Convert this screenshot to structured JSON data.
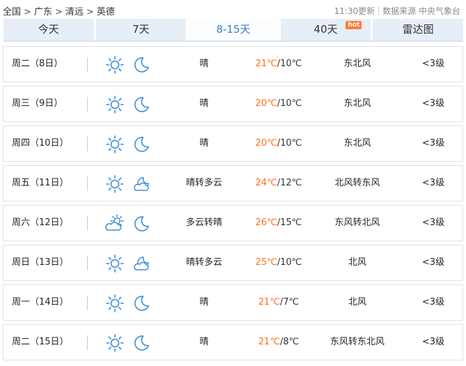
{
  "breadcrumb": {
    "items": [
      "全国",
      "广东",
      "清远",
      "英德"
    ],
    "separator": ">"
  },
  "update_time": "11:30更新",
  "source": "数据来源 中央气象台",
  "tabs": [
    {
      "label": "今天"
    },
    {
      "label": "7天"
    },
    {
      "label": "8-15天",
      "active": true
    },
    {
      "label": "40天",
      "badge": "hot"
    },
    {
      "label": "雷达图"
    }
  ],
  "days": [
    {
      "date": "周二（8日）",
      "day_icon": "sun-icon",
      "night_icon": "moon-icon",
      "weather": "晴",
      "high": "21℃",
      "low": "/10℃",
      "wind": "东北风",
      "level": "<3级"
    },
    {
      "date": "周三（9日）",
      "day_icon": "sun-icon",
      "night_icon": "moon-icon",
      "weather": "晴",
      "high": "20℃",
      "low": "/10℃",
      "wind": "东北风",
      "level": "<3级"
    },
    {
      "date": "周四（10日）",
      "day_icon": "sun-icon",
      "night_icon": "moon-icon",
      "weather": "晴",
      "high": "20℃",
      "low": "/10℃",
      "wind": "东北风",
      "level": "<3级"
    },
    {
      "date": "周五（11日）",
      "day_icon": "sun-icon",
      "night_icon": "moon-cloud-icon",
      "weather": "晴转多云",
      "high": "24℃",
      "low": "/12℃",
      "wind": "北风转东风",
      "level": "<3级"
    },
    {
      "date": "周六（12日）",
      "day_icon": "sun-cloud-icon",
      "night_icon": "moon-icon",
      "weather": "多云转晴",
      "high": "26℃",
      "low": "/15℃",
      "wind": "东风转北风",
      "level": "<3级"
    },
    {
      "date": "周日（13日）",
      "day_icon": "sun-icon",
      "night_icon": "moon-cloud-icon",
      "weather": "晴转多云",
      "high": "25℃",
      "low": "/10℃",
      "wind": "北风",
      "level": "<3级"
    },
    {
      "date": "周一（14日）",
      "day_icon": "sun-icon",
      "night_icon": "moon-icon",
      "weather": "晴",
      "high": "21℃",
      "low": "/7℃",
      "wind": "北风",
      "level": "<3级"
    },
    {
      "date": "周二（15日）",
      "day_icon": "sun-icon",
      "night_icon": "moon-icon",
      "weather": "晴",
      "high": "21℃",
      "low": "/8℃",
      "wind": "东风转东北风",
      "level": "<3级"
    }
  ],
  "colors": {
    "icon_blue": "#3a8ed6",
    "high_temp": "#ff6e1a",
    "active_tab_text": "#3a7fc6",
    "tab_bg": "#e6eef8",
    "hot_badge": "#ff7e3b"
  }
}
